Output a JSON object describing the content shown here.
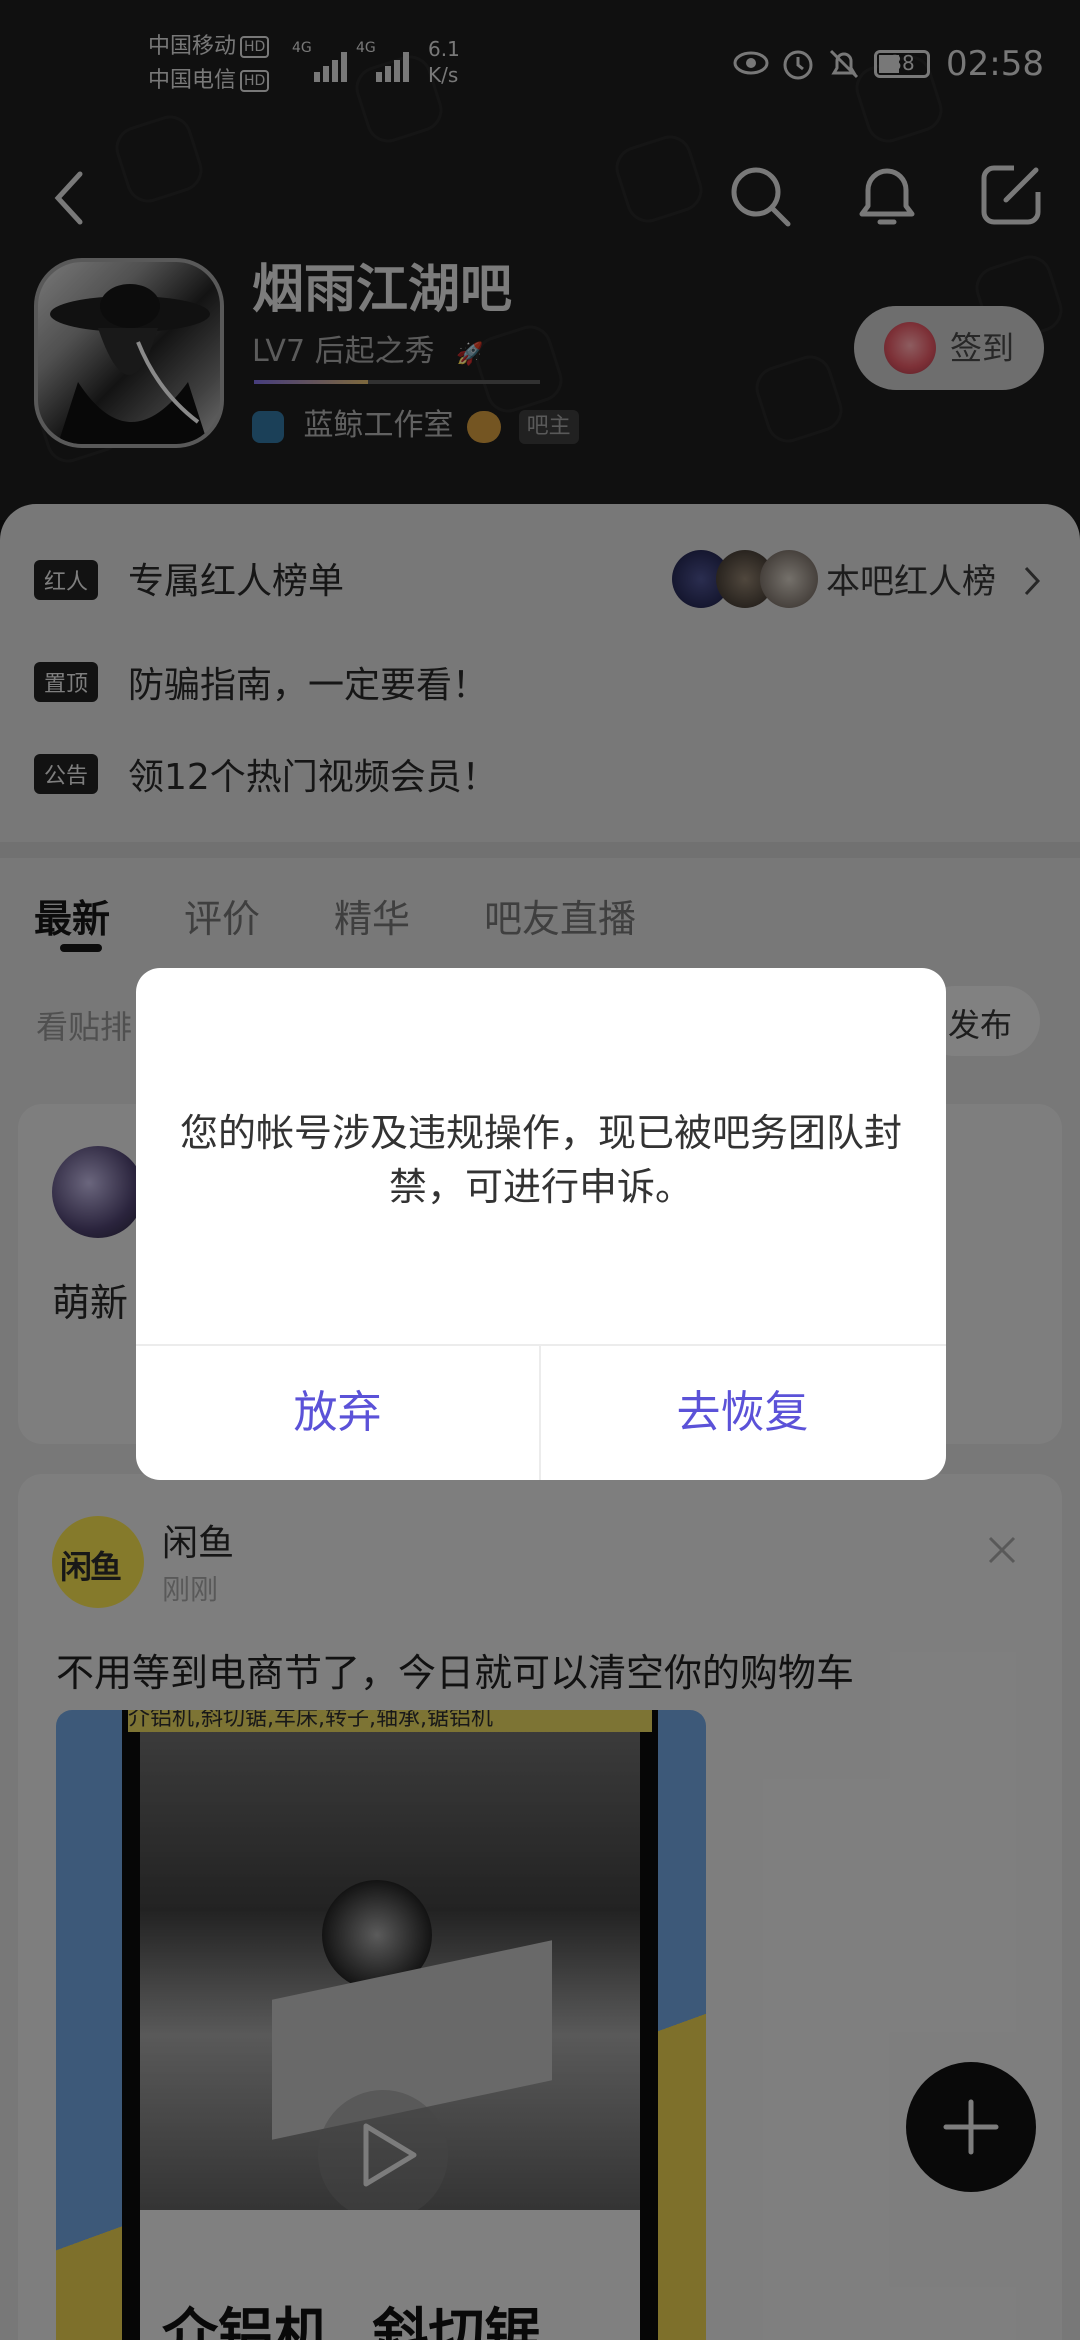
{
  "status_bar": {
    "carrier1": "中国移动",
    "carrier2": "中国电信",
    "hd": "HD",
    "net1": "4G",
    "net2": "4G",
    "speed_value": "6.1",
    "speed_unit": "K/s",
    "battery": "38",
    "time": "02:58"
  },
  "forum": {
    "name": "烟雨江湖吧",
    "level": "LV7 后起之秀",
    "owner": "蓝鲸工作室",
    "owner_badge": "吧主",
    "signin_label": "签到"
  },
  "announcements": [
    {
      "tag": "红人",
      "text": "专属红人榜单",
      "right_label": "本吧红人榜"
    },
    {
      "tag": "置顶",
      "text": "防骗指南，一定要看！"
    },
    {
      "tag": "公告",
      "text": "领12个热门视频会员！"
    }
  ],
  "tabs": [
    "最新",
    "评价",
    "精华",
    "吧友直播"
  ],
  "sort": {
    "left_text": "看贴排",
    "publish": "发布"
  },
  "post1": {
    "snippet": "萌新"
  },
  "post2": {
    "author": "闲鱼",
    "logo_text": "闲鱼",
    "time": "刚刚",
    "title": "不用等到电商节了，今日就可以清空你的购物车",
    "video_top_text": "介铝机,斜切锯,车床,转子,轴承,锯铝机",
    "video_bottom_text": "介铝机,,斜切锯,"
  },
  "dialog": {
    "message": "您的帐号涉及违规操作，现已被吧务团队封禁，可进行申诉。",
    "cancel_label": "放弃",
    "confirm_label": "去恢复"
  },
  "colors": {
    "accent": "#5b52d8",
    "dialog_bg": "#ffffff",
    "header_bg": "#1c1c1c"
  }
}
